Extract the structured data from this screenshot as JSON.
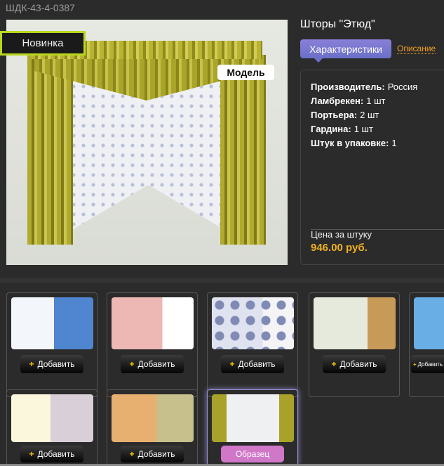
{
  "sku": "ШДК-43-4-0387",
  "badge": "Новинка",
  "model_label": "Модель",
  "title": "Шторы \"Этюд\"",
  "tabs": [
    "Характеристики",
    "Описание"
  ],
  "props": [
    {
      "k": "Производитель:",
      "v": "Россия"
    },
    {
      "k": "Ламбрекен:",
      "v": "1 шт"
    },
    {
      "k": "Портьера:",
      "v": "2 шт"
    },
    {
      "k": "Гардина:",
      "v": "1 шт"
    },
    {
      "k": "Штук в упаковке:",
      "v": "1"
    }
  ],
  "price_label": "Цена за штуку",
  "price": "946.00 руб.",
  "add_label": "Добавить",
  "sample_label": "Образец",
  "plus": "+"
}
